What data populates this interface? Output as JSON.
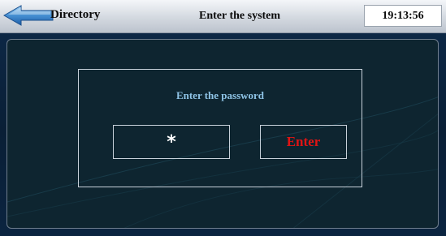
{
  "header": {
    "back_label": "Directory",
    "title": "Enter the system",
    "clock": "19:13:56"
  },
  "login": {
    "prompt": "Enter the password",
    "password_masked": "*",
    "enter_label": "Enter"
  },
  "colors": {
    "accent_blue": "#3f86c8",
    "prompt_text": "#8fc4e6",
    "enter_text": "#e01414",
    "panel_bg": "#0e2530"
  },
  "icons": {
    "back": "arrow-left-icon"
  }
}
